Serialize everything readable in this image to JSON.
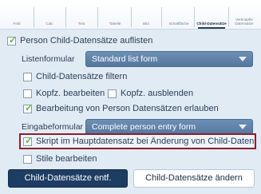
{
  "tabs": [
    {
      "label": "Feld"
    },
    {
      "label": "Calc"
    },
    {
      "label": "Text"
    },
    {
      "label": "Tabelle"
    },
    {
      "label": "Bild"
    },
    {
      "label": "Schaltfläche"
    },
    {
      "label": "Child-Datensätze"
    },
    {
      "label": "Verknüpfte Datensätze"
    }
  ],
  "active_tab": "Child-Datensätze",
  "options": {
    "list_children": {
      "label": "Person Child-Datensätze auflisten",
      "checked": true
    },
    "list_form_label": "Listenformular",
    "list_form_value": "Standard list form",
    "filter_children": {
      "label": "Child-Datensätze filtern",
      "checked": false
    },
    "edit_headers": {
      "label": "Kopfz. bearbeiten",
      "checked": false
    },
    "hide_headers": {
      "label": "Kopfz. ausblenden",
      "checked": false
    },
    "allow_edit": {
      "label": "Bearbeitung von Person Datensätzen erlauben",
      "checked": true
    },
    "entry_form_label": "Eingabeformular",
    "entry_form_value": "Complete person entry form",
    "script_on_change": {
      "label": "Skript im Hauptdatensatz bei Änderung von Child-Datensätzen",
      "checked": true
    },
    "edit_styles": {
      "label": "Stile bearbeiten",
      "checked": false
    }
  },
  "buttons": {
    "remove_children": "Child-Datensätze entf.",
    "change_children": "Child-Datensätze ändern"
  },
  "colors": {
    "accent": "#1d3d63",
    "select": "#5f83aa",
    "highlight_border": "#8a1f2c",
    "check": "#5fb84b"
  }
}
